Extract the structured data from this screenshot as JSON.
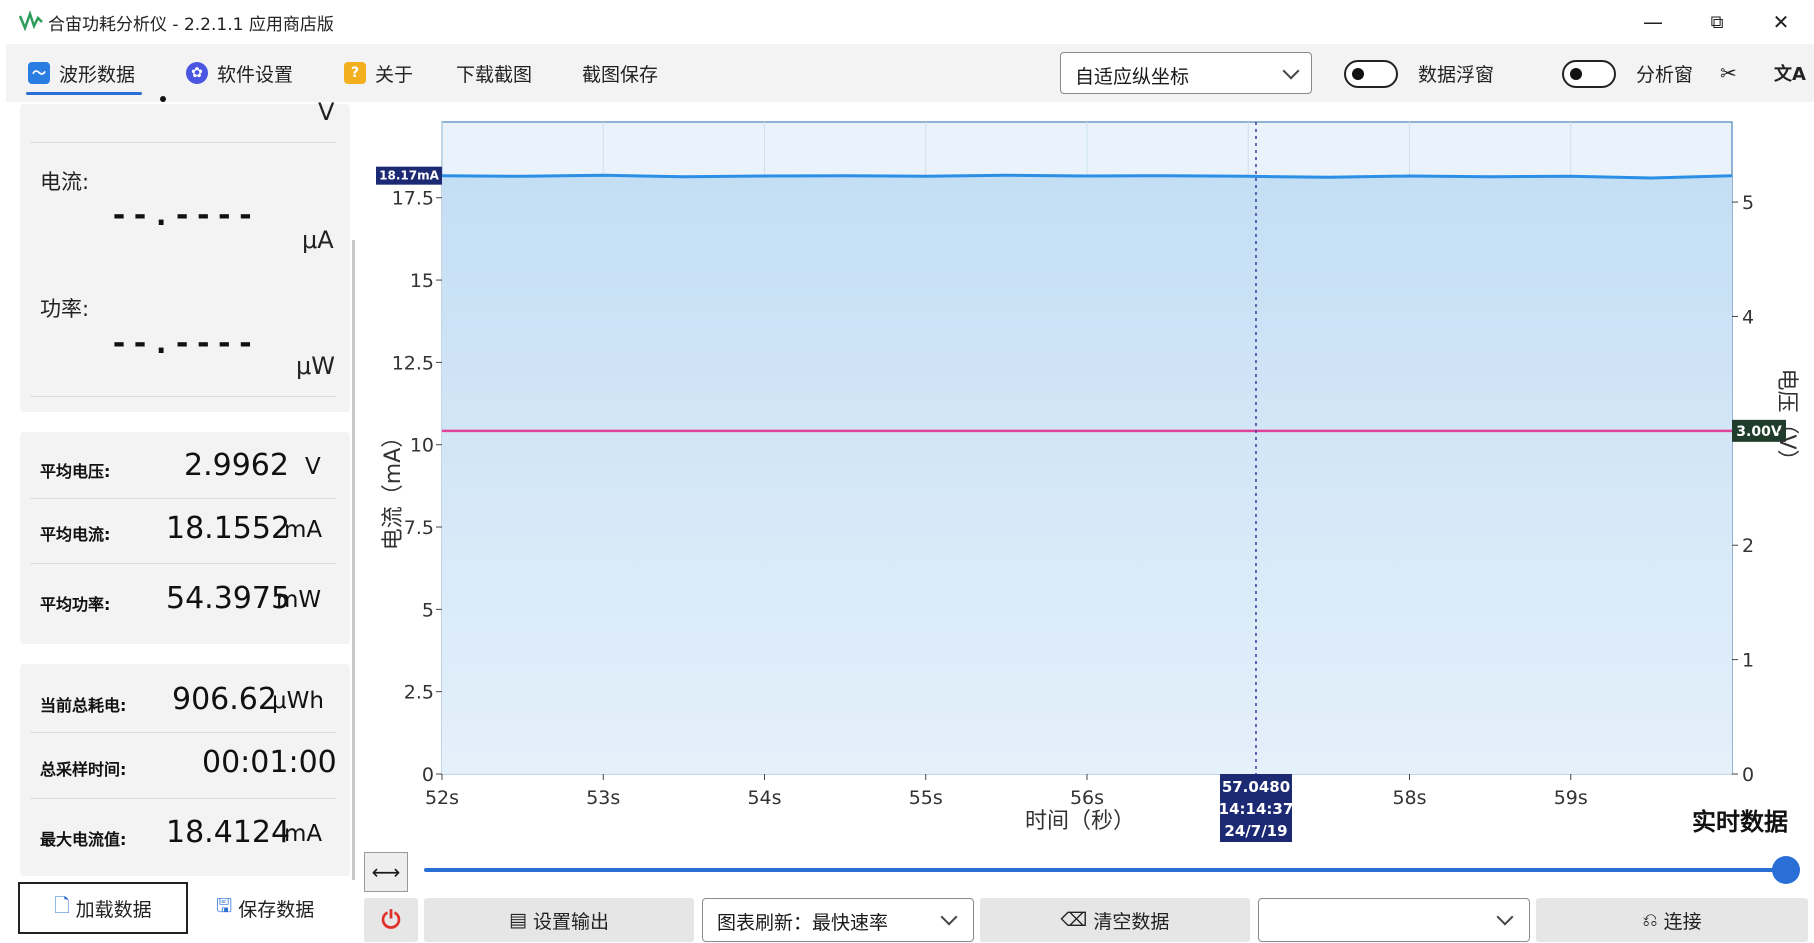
{
  "app": {
    "title": "合宙功耗分析仪 - 2.2.1.1 应用商店版"
  },
  "window_controls": {
    "minimize": "—",
    "restore": "⧉",
    "close": "✕"
  },
  "toolbar": {
    "tab_waveform": "波形数据",
    "tab_settings": "软件设置",
    "tab_about": "关于",
    "download_screenshot": "下载截图",
    "save_screenshot": "截图保存",
    "axis_mode": "自适应纵坐标",
    "data_float_label": "数据浮窗",
    "analysis_label": "分析窗"
  },
  "live": {
    "voltage_unit": "V",
    "current_label": "电流:",
    "current_reading": "--.----",
    "current_unit": "μA",
    "power_label": "功率:",
    "power_reading": "--.----",
    "power_unit": "μW"
  },
  "stats": {
    "avg_voltage_label": "平均电压:",
    "avg_voltage": "2.9962",
    "avg_voltage_unit": "V",
    "avg_current_label": "平均电流:",
    "avg_current": "18.1552",
    "avg_current_unit": "mA",
    "avg_power_label": "平均功率:",
    "avg_power": "54.3975",
    "avg_power_unit": "mW",
    "total_energy_label": "当前总耗电:",
    "total_energy": "906.62",
    "total_energy_unit": "μWh",
    "sample_time_label": "总采样时间:",
    "sample_time": "00:01:00",
    "max_current_label": "最大电流值:",
    "max_current": "18.4124",
    "max_current_unit": "mA"
  },
  "bottom": {
    "load_data": "加载数据",
    "save_data": "保存数据",
    "set_output": "设置输出",
    "refresh_select": "图表刷新：最快速率",
    "clear_data": "清空数据",
    "port_select": "",
    "connect": "连接"
  },
  "chart_data": {
    "type": "area",
    "ylabel": "电流（mA）",
    "ylabel2": "电压（V）",
    "xlabel": "时间（秒）",
    "status_label": "实时数据",
    "x_ticks": [
      "52s",
      "53s",
      "54s",
      "55s",
      "56s",
      "57s",
      "58s",
      "59s"
    ],
    "xlim": [
      52,
      60
    ],
    "y_ticks": [
      "0",
      "2.5",
      "5",
      "7.5",
      "10",
      "12.5",
      "15",
      "17.5"
    ],
    "ylim": [
      0,
      19.8
    ],
    "y2_ticks": [
      "0",
      "1",
      "2",
      "3",
      "4",
      "5"
    ],
    "y2lim": [
      0,
      5.7
    ],
    "series": [
      {
        "name": "电流",
        "axis": "left",
        "color": "#2b8fe6",
        "x": [
          52,
          52.5,
          53,
          53.5,
          54,
          54.5,
          55,
          55.5,
          56,
          56.5,
          57,
          57.5,
          58,
          58.5,
          59,
          59.5,
          60
        ],
        "values": [
          18.17,
          18.15,
          18.18,
          18.14,
          18.16,
          18.17,
          18.15,
          18.18,
          18.16,
          18.17,
          18.15,
          18.12,
          18.16,
          18.14,
          18.15,
          18.1,
          18.17
        ]
      },
      {
        "name": "电压",
        "axis": "right",
        "color": "#e0449a",
        "x": [
          52,
          60
        ],
        "values": [
          3.0,
          3.0
        ]
      }
    ],
    "current_marker": "18.17mA",
    "voltage_marker": "3.00V",
    "cursor": {
      "x": 57.048,
      "value": "57.0480",
      "time": "14:14:37",
      "date": "24/7/19"
    },
    "grid": true
  }
}
